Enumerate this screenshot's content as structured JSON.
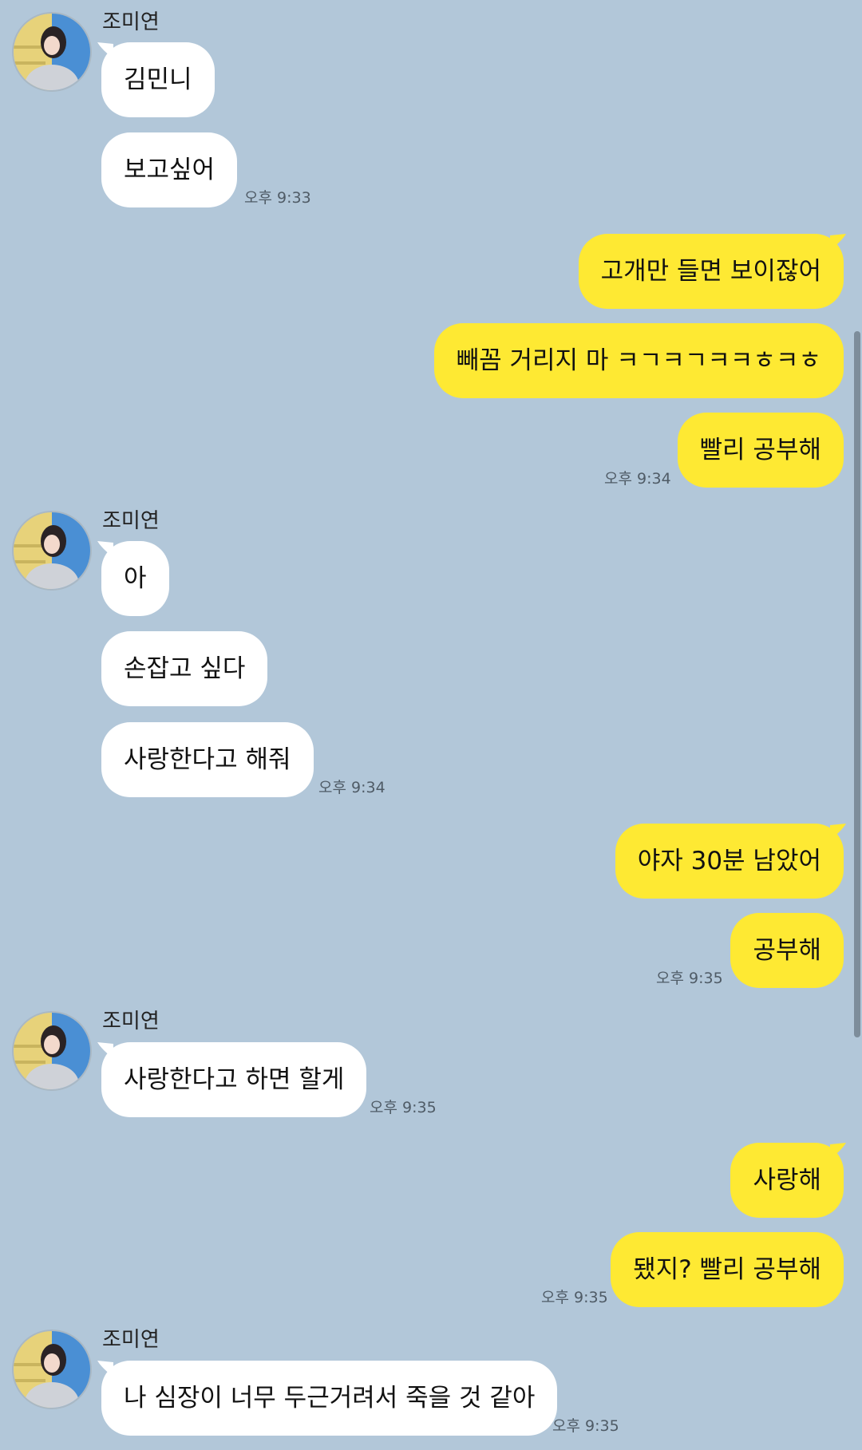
{
  "contact": {
    "name": "조미연"
  },
  "colors": {
    "background": "#b2c7d9",
    "incoming_bubble": "#ffffff",
    "outgoing_bubble": "#fee933",
    "timestamp": "#4f5b66"
  },
  "messages": [
    {
      "from": "them",
      "text": "김민니"
    },
    {
      "from": "them",
      "text": "보고싶어",
      "time": "오후 9:33"
    },
    {
      "from": "me",
      "text": "고개만 들면 보이잖어"
    },
    {
      "from": "me",
      "text": "빼꼼 거리지 마 ㅋㄱㅋㄱㅋㅋㅎㅋㅎ"
    },
    {
      "from": "me",
      "text": "빨리 공부해",
      "time": "오후 9:34"
    },
    {
      "from": "them",
      "text": "아"
    },
    {
      "from": "them",
      "text": "손잡고 싶다"
    },
    {
      "from": "them",
      "text": "사랑한다고 해줘",
      "time": "오후 9:34"
    },
    {
      "from": "me",
      "text": "야자 30분 남았어"
    },
    {
      "from": "me",
      "text": "공부해",
      "time": "오후 9:35"
    },
    {
      "from": "them",
      "text": "사랑한다고 하면 할게",
      "time": "오후 9:35"
    },
    {
      "from": "me",
      "text": "사랑해"
    },
    {
      "from": "me",
      "text": "됐지? 빨리 공부해",
      "time": "오후 9:35"
    },
    {
      "from": "them",
      "text": "나 심장이 너무 두근거려서 죽을 것 같아",
      "time": "오후 9:35"
    }
  ]
}
